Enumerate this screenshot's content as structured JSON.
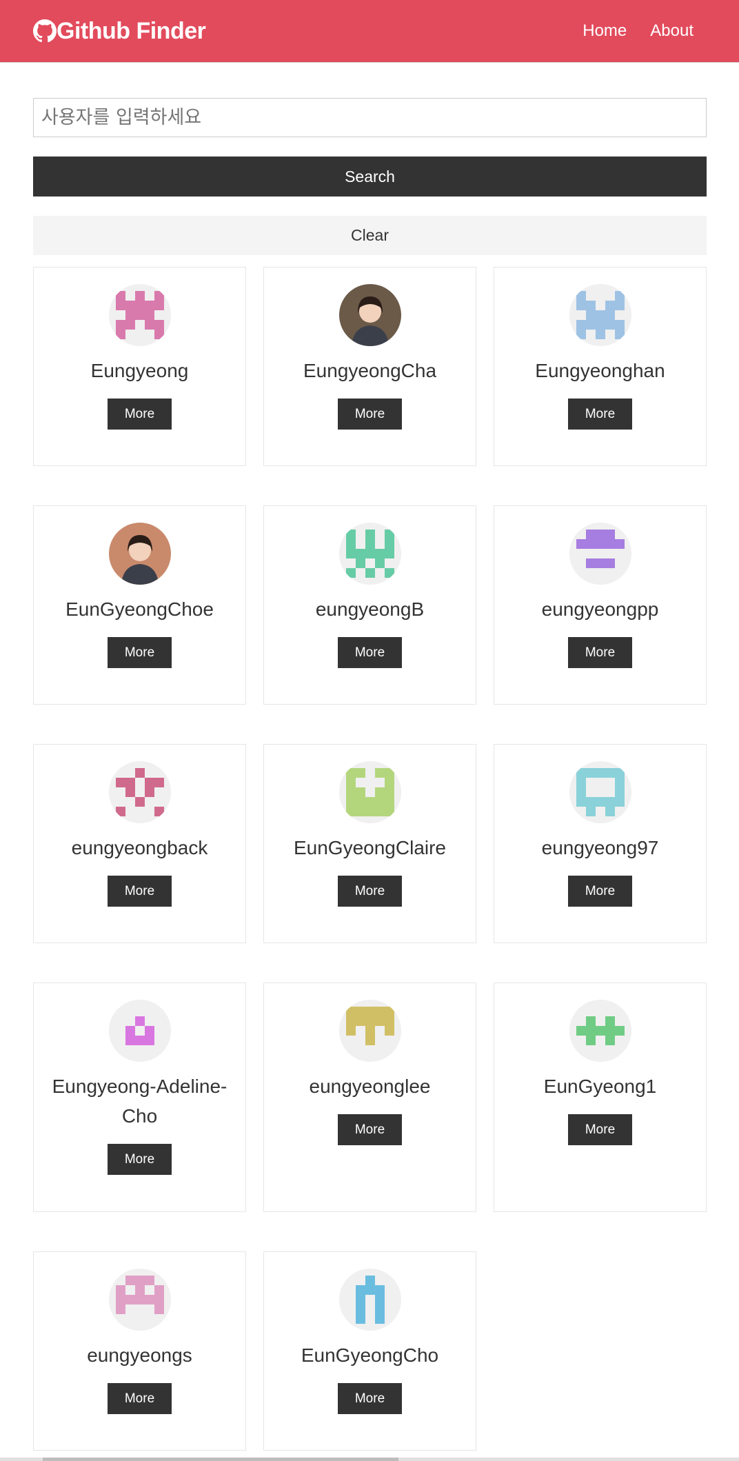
{
  "navbar": {
    "title": "Github Finder",
    "icon": "github-icon",
    "links": [
      "Home",
      "About"
    ],
    "color": "#e24b5c"
  },
  "search": {
    "placeholder": "사용자를 입력하세요",
    "value": "",
    "search_label": "Search",
    "clear_label": "Clear"
  },
  "more_label": "More",
  "users": [
    {
      "login": "Eungyeong",
      "avatar": "identicon",
      "color": "#d97aad",
      "pattern": [
        "10101",
        "11111",
        "01110",
        "11011",
        "10001"
      ]
    },
    {
      "login": "EungyeongCha",
      "avatar": "photo",
      "color": "#6b5a48"
    },
    {
      "login": "Eungyeonghan",
      "avatar": "identicon",
      "color": "#9ec2e4",
      "pattern": [
        "10001",
        "11011",
        "01110",
        "11111",
        "10101"
      ]
    },
    {
      "login": "EunGyeongChoe",
      "avatar": "photo",
      "color": "#c98a6c"
    },
    {
      "login": "eungyeongB",
      "avatar": "identicon",
      "color": "#66cca6",
      "pattern": [
        "10101",
        "10101",
        "11111",
        "01010",
        "10101"
      ]
    },
    {
      "login": "eungyeongpp",
      "avatar": "identicon",
      "color": "#a67de0",
      "pattern": [
        "01110",
        "11111",
        "00000",
        "01110",
        "00000"
      ]
    },
    {
      "login": "eungyeongback",
      "avatar": "identicon",
      "color": "#d06a8c",
      "pattern": [
        "00100",
        "11011",
        "01010",
        "00100",
        "10001"
      ]
    },
    {
      "login": "EunGyeongClaire",
      "avatar": "identicon",
      "color": "#b3d67d",
      "pattern": [
        "11011",
        "10001",
        "11011",
        "11111",
        "11111"
      ]
    },
    {
      "login": "eungyeong97",
      "avatar": "identicon",
      "color": "#8ad1d9",
      "pattern": [
        "11111",
        "10001",
        "10001",
        "11111",
        "01010"
      ]
    },
    {
      "login": "Eungyeong-Adeline-Cho",
      "avatar": "identicon",
      "color": "#d977e0",
      "pattern": [
        "00000",
        "00100",
        "01010",
        "01110",
        "00000"
      ]
    },
    {
      "login": "eungyeonglee",
      "avatar": "identicon",
      "color": "#d1bf66",
      "pattern": [
        "11111",
        "11111",
        "10101",
        "00100",
        "00000"
      ]
    },
    {
      "login": "EunGyeong1",
      "avatar": "identicon",
      "color": "#70cc85",
      "pattern": [
        "00000",
        "01010",
        "11111",
        "01010",
        "00000"
      ]
    },
    {
      "login": "eungyeongs",
      "avatar": "identicon",
      "color": "#e0a0c6",
      "pattern": [
        "01110",
        "10101",
        "11111",
        "10001",
        "00000"
      ]
    },
    {
      "login": "EunGyeongCho",
      "avatar": "identicon",
      "color": "#6bbde0",
      "pattern": [
        "00100",
        "01110",
        "01010",
        "01010",
        "01010"
      ]
    }
  ]
}
